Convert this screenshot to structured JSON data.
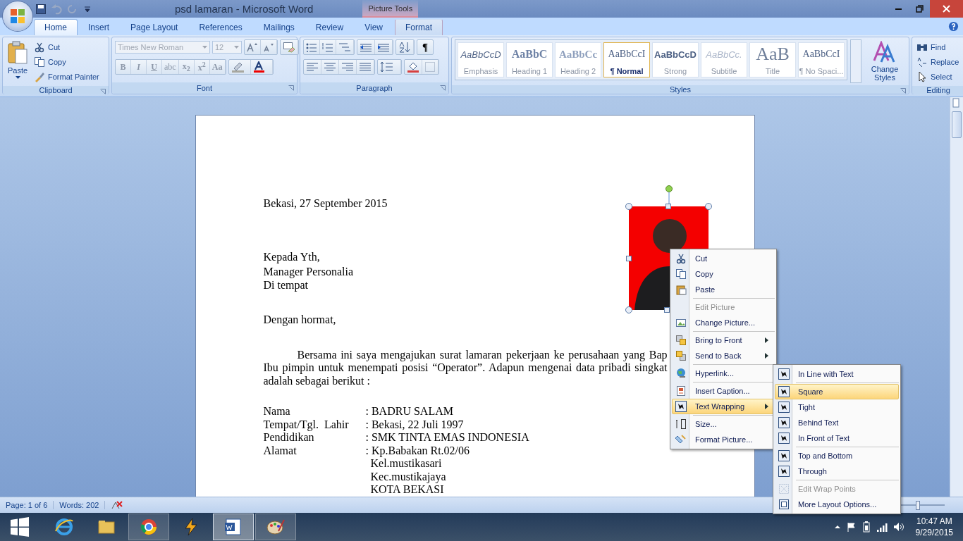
{
  "window": {
    "title": "psd lamaran - Microsoft Word",
    "context_label": "Picture Tools"
  },
  "tabs": [
    {
      "label": "Home",
      "selected": true,
      "kind": "normal"
    },
    {
      "label": "Insert",
      "selected": false,
      "kind": "normal"
    },
    {
      "label": "Page Layout",
      "selected": false,
      "kind": "normal"
    },
    {
      "label": "References",
      "selected": false,
      "kind": "normal"
    },
    {
      "label": "Mailings",
      "selected": false,
      "kind": "normal"
    },
    {
      "label": "Review",
      "selected": false,
      "kind": "normal"
    },
    {
      "label": "View",
      "selected": false,
      "kind": "normal"
    },
    {
      "label": "Format",
      "selected": false,
      "kind": "contextual"
    }
  ],
  "clipboard": {
    "label": "Clipboard",
    "paste": "Paste",
    "actions": [
      "Cut",
      "Copy",
      "Format Painter"
    ]
  },
  "font": {
    "label": "Font",
    "name": "Times New Roman",
    "size": "12",
    "disabled": true,
    "format_buttons": [
      "B",
      "I",
      "U",
      "abc",
      "x$_{2}$",
      "x$^{2}$",
      "Aa"
    ]
  },
  "paragraph": {
    "label": "Paragraph",
    "pilcrow": "¶"
  },
  "styles": {
    "label": "Styles",
    "change": "Change Styles",
    "items": [
      {
        "kind": "emphasis",
        "preview": "AaBbCcD",
        "label": "Emphasis",
        "selected": false
      },
      {
        "kind": "heading1",
        "preview": "AaBbC",
        "label": "Heading 1",
        "selected": false
      },
      {
        "kind": "heading2",
        "preview": "AaBbCc",
        "label": "Heading 2",
        "selected": false
      },
      {
        "kind": "normal",
        "preview": "AaBbCcI",
        "label": "¶ Normal",
        "selected": true
      },
      {
        "kind": "strong",
        "preview": "AaBbCcD",
        "label": "Strong",
        "selected": false
      },
      {
        "kind": "subtitle",
        "preview": "AaBbCc.",
        "label": "Subtitle",
        "selected": false
      },
      {
        "kind": "title",
        "preview": "AaB",
        "label": "Title",
        "selected": false
      },
      {
        "kind": "normal",
        "preview": "AaBbCcI",
        "label": "¶ No Spaci...",
        "selected": false
      }
    ]
  },
  "editing": {
    "label": "Editing",
    "actions": [
      "Find",
      "Replace",
      "Select"
    ]
  },
  "document": {
    "date": "Bekasi, 27 September 2015",
    "recipient": [
      "Kepada Yth,",
      "Manager Personalia",
      "Di tempat"
    ],
    "greeting": "Dengan hormat,",
    "body": [
      "Bersama ini saya mengajukan surat lamaran pekerjaan ke perusahaan yang Bap",
      "Ibu pimpin untuk menempati posisi “Operator”. Adapun mengenai data pribadi singkat",
      "adalah sebagai berikut :"
    ],
    "details": [
      {
        "label": "Nama",
        "value": ": BADRU SALAM"
      },
      {
        "label": "Tempat/Tgl.  Lahir",
        "value": ": Bekasi, 22 Juli 1997"
      },
      {
        "label": "Pendidikan",
        "value": ": SMK TINTA EMAS INDONESIA"
      },
      {
        "label": "Alamat",
        "value": ": Kp.Babakan Rt.02/06",
        "more": [
          "Kel.mustikasari",
          "Kec.mustikajaya",
          "KOTA BEKASI"
        ]
      }
    ]
  },
  "context_menu": {
    "sections": [
      [
        {
          "label": "Cut",
          "disabled": false,
          "submenu": false,
          "selected": false
        },
        {
          "label": "Copy",
          "disabled": false,
          "submenu": false,
          "selected": false
        },
        {
          "label": "Paste",
          "disabled": false,
          "submenu": false,
          "selected": false
        }
      ],
      [
        {
          "label": "Edit Picture",
          "disabled": true,
          "submenu": false,
          "selected": false
        },
        {
          "label": "Change Picture...",
          "disabled": false,
          "submenu": false,
          "selected": false
        }
      ],
      [
        {
          "label": "Bring to Front",
          "disabled": false,
          "submenu": true,
          "selected": false
        },
        {
          "label": "Send to Back",
          "disabled": false,
          "submenu": true,
          "selected": false
        }
      ],
      [
        {
          "label": "Hyperlink...",
          "disabled": false,
          "submenu": false,
          "selected": false
        }
      ],
      [
        {
          "label": "Insert Caption...",
          "disabled": false,
          "submenu": false,
          "selected": false
        },
        {
          "label": "Text Wrapping",
          "disabled": false,
          "submenu": true,
          "selected": true
        }
      ],
      [
        {
          "label": "Size...",
          "disabled": false,
          "submenu": false,
          "selected": false
        },
        {
          "label": "Format Picture...",
          "disabled": false,
          "submenu": false,
          "selected": false
        }
      ]
    ]
  },
  "wrap_menu": {
    "sections": [
      [
        {
          "label": "In Line with Text",
          "disabled": false,
          "selected": false
        }
      ],
      [
        {
          "label": "Square",
          "disabled": false,
          "selected": true
        },
        {
          "label": "Tight",
          "disabled": false,
          "selected": false
        },
        {
          "label": "Behind Text",
          "disabled": false,
          "selected": false
        },
        {
          "label": "In Front of Text",
          "disabled": false,
          "selected": false
        }
      ],
      [
        {
          "label": "Top and Bottom",
          "disabled": false,
          "selected": false
        },
        {
          "label": "Through",
          "disabled": false,
          "selected": false
        }
      ],
      [
        {
          "label": "Edit Wrap Points",
          "disabled": true,
          "selected": false
        },
        {
          "label": "More Layout Options...",
          "disabled": false,
          "selected": false
        }
      ]
    ]
  },
  "status_bar": {
    "page": "Page: 1 of 6",
    "words": "Words: 202",
    "zoom": {
      "level": 0.5
    }
  },
  "taskbar": {
    "apps": [
      {
        "kind": "browser-e",
        "running": false,
        "selected": false
      },
      {
        "kind": "folder",
        "running": false,
        "selected": false
      },
      {
        "kind": "browser-ring",
        "running": true,
        "selected": false
      },
      {
        "kind": "bolt",
        "running": false,
        "selected": false
      },
      {
        "kind": "document",
        "running": true,
        "selected": true
      },
      {
        "kind": "palette",
        "running": true,
        "selected": false
      }
    ],
    "time": "10:47 AM",
    "date": "9/29/2015"
  }
}
